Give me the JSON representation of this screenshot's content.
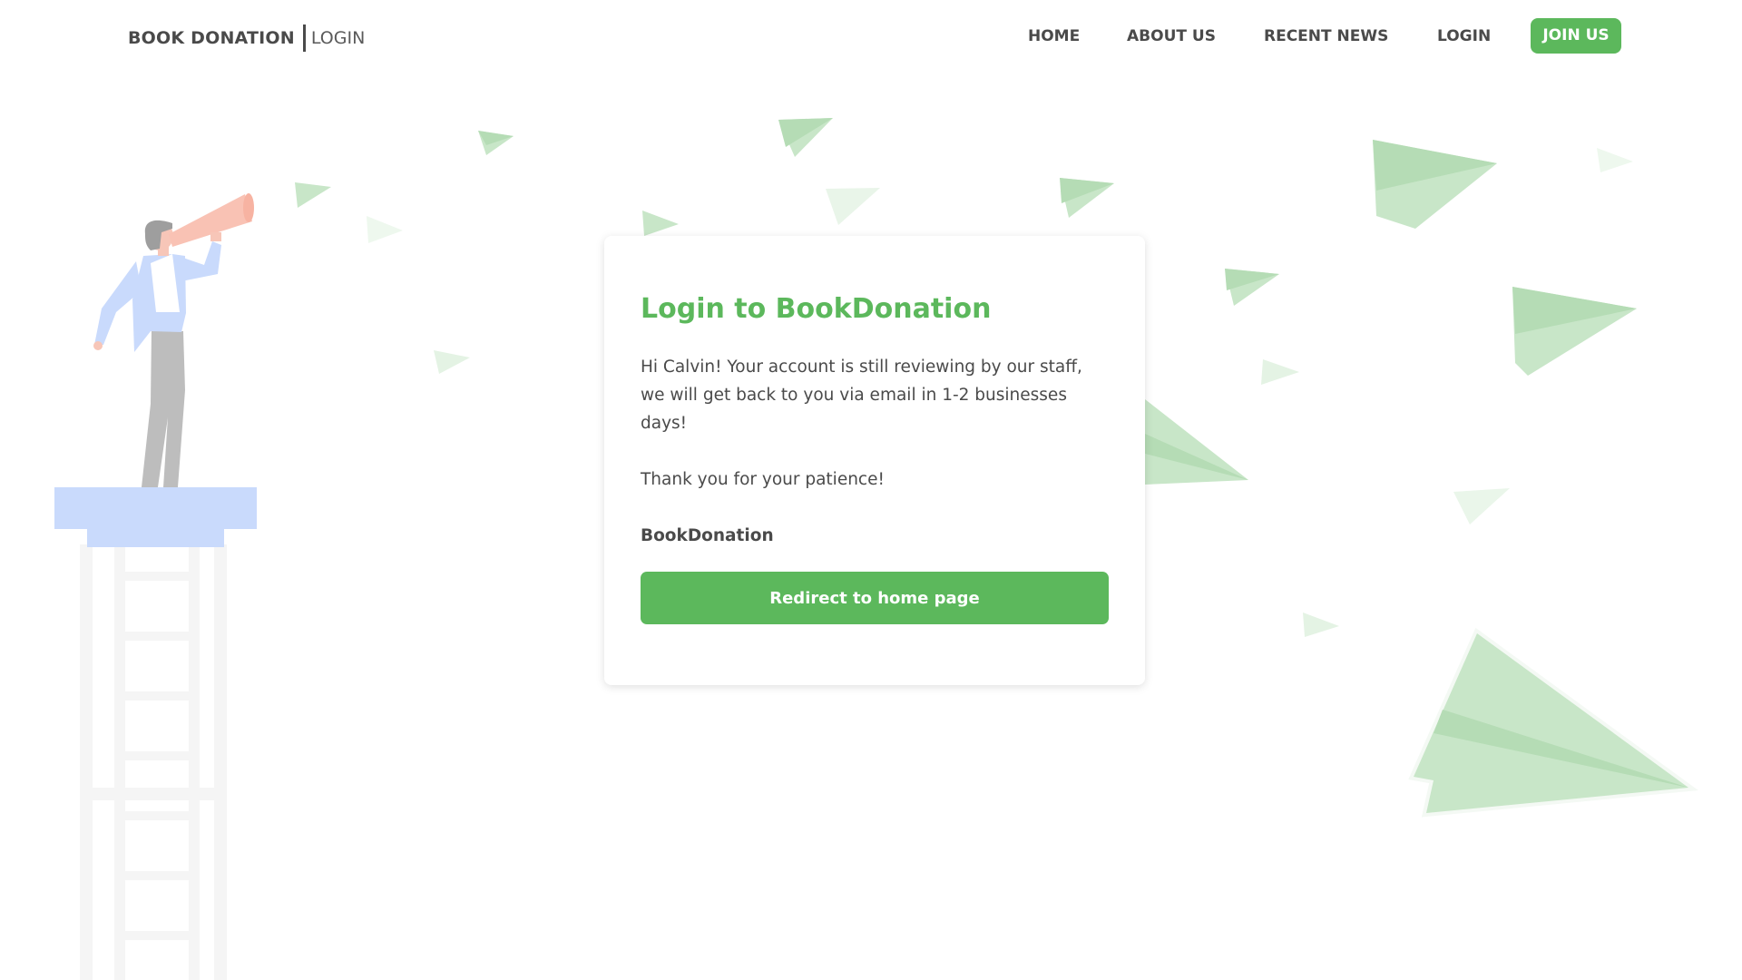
{
  "header": {
    "brand_name": "BOOK DONATION",
    "brand_sub": "LOGIN",
    "nav": {
      "home": "HOME",
      "about": "ABOUT US",
      "news": "RECENT NEWS",
      "login": "LOGIN",
      "join": "JOIN US"
    }
  },
  "card": {
    "title": "Login to BookDonation",
    "message": "Hi Calvin! Your account is still reviewing by our staff, we will get back to you via email in 1-2 businesses days!",
    "thanks": "Thank you for your patience!",
    "signature": "BookDonation",
    "button_label": "Redirect to home page"
  },
  "colors": {
    "accent": "#5cb85c",
    "text": "#4a4a4a",
    "plane": "#c9e7c9",
    "platform": "#c9dafc"
  },
  "icons": {
    "illustration": "person-with-megaphone",
    "decoration": "paper-planes"
  }
}
